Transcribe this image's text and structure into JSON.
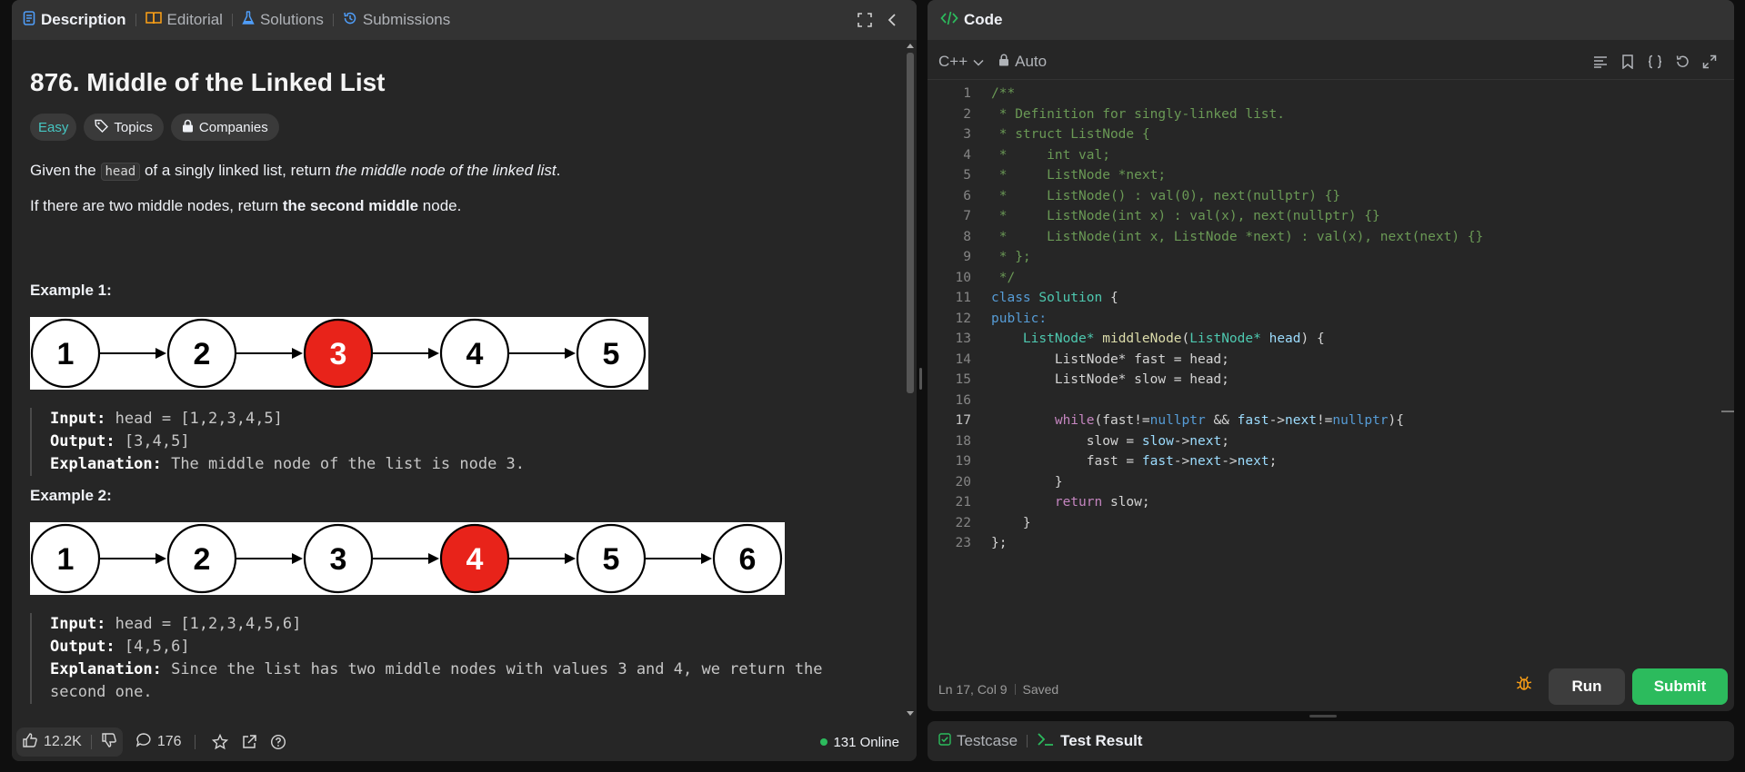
{
  "left_tabs": [
    {
      "label": "Description",
      "icon": "document-icon",
      "active": true
    },
    {
      "label": "Editorial",
      "icon": "book-icon",
      "active": false
    },
    {
      "label": "Solutions",
      "icon": "flask-icon",
      "active": false
    },
    {
      "label": "Submissions",
      "icon": "history-icon",
      "active": false
    }
  ],
  "problem": {
    "title": "876. Middle of the Linked List",
    "difficulty": "Easy",
    "topics_label": "Topics",
    "companies_label": "Companies",
    "para1_prefix": "Given the ",
    "para1_code": "head",
    "para1_middle": " of a singly linked list, return ",
    "para1_em": "the middle node of the linked list",
    "para1_suffix": ".",
    "para2_prefix": "If there are two middle nodes, return ",
    "para2_bold": "the second middle",
    "para2_suffix": " node."
  },
  "examples": [
    {
      "title": "Example 1:",
      "nodes": [
        "1",
        "2",
        "3",
        "4",
        "5"
      ],
      "highlight_index": 2,
      "input_label": "Input:",
      "input": "head = [1,2,3,4,5]",
      "output_label": "Output:",
      "output": "[3,4,5]",
      "explanation_label": "Explanation:",
      "explanation": "The middle node of the list is node 3."
    },
    {
      "title": "Example 2:",
      "nodes": [
        "1",
        "2",
        "3",
        "4",
        "5",
        "6"
      ],
      "highlight_index": 3,
      "input_label": "Input:",
      "input": "head = [1,2,3,4,5,6]",
      "output_label": "Output:",
      "output": "[4,5,6]",
      "explanation_label": "Explanation:",
      "explanation": "Since the list has two middle nodes with values 3 and 4, we return the",
      "explanation_cut": "second one."
    }
  ],
  "bottom_bar": {
    "likes": "12.2K",
    "comments": "176",
    "online": "131 Online"
  },
  "code_panel": {
    "title": "Code",
    "language": "C++",
    "mode": "Auto",
    "status_position": "Ln 17, Col 9",
    "status_saved": "Saved",
    "run_label": "Run",
    "submit_label": "Submit",
    "current_line": 17
  },
  "result_tabs": [
    {
      "label": "Testcase",
      "icon": "checkbox-icon",
      "active": false
    },
    {
      "label": "Test Result",
      "icon": "terminal-icon",
      "active": true
    }
  ],
  "code_lines": [
    [
      [
        "cm",
        "/**"
      ]
    ],
    [
      [
        "cm",
        " * Definition for singly-linked list."
      ]
    ],
    [
      [
        "cm",
        " * struct ListNode {"
      ]
    ],
    [
      [
        "cm",
        " *     int val;"
      ]
    ],
    [
      [
        "cm",
        " *     ListNode *next;"
      ]
    ],
    [
      [
        "cm",
        " *     ListNode() : val(0), next(nullptr) {}"
      ]
    ],
    [
      [
        "cm",
        " *     ListNode(int x) : val(x), next(nullptr) {}"
      ]
    ],
    [
      [
        "cm",
        " *     ListNode(int x, ListNode *next) : val(x), next(next) {}"
      ]
    ],
    [
      [
        "cm",
        " * };"
      ]
    ],
    [
      [
        "cm",
        " */"
      ]
    ],
    [
      [
        "kw",
        "class"
      ],
      [
        "",
        " "
      ],
      [
        "ty",
        "Solution"
      ],
      [
        "",
        " {"
      ]
    ],
    [
      [
        "kw",
        "public:"
      ]
    ],
    [
      [
        "",
        "    "
      ],
      [
        "ty",
        "ListNode*"
      ],
      [
        "",
        " "
      ],
      [
        "fn",
        "middleNode"
      ],
      [
        "",
        "("
      ],
      [
        "ty",
        "ListNode*"
      ],
      [
        "",
        " "
      ],
      [
        "va",
        "head"
      ],
      [
        "",
        ") {"
      ]
    ],
    [
      [
        "",
        "        ListNode* fast = head;"
      ]
    ],
    [
      [
        "",
        "        ListNode* slow = head;"
      ]
    ],
    [
      [
        "",
        ""
      ]
    ],
    [
      [
        "",
        "        "
      ],
      [
        "kc",
        "while"
      ],
      [
        "",
        "(fast!="
      ],
      [
        "kw",
        "nullptr"
      ],
      [
        "",
        " && "
      ],
      [
        "va",
        "fast"
      ],
      [
        "",
        "->"
      ],
      [
        "va",
        "next"
      ],
      [
        "",
        "!="
      ],
      [
        "kw",
        "nullptr"
      ],
      [
        "",
        "){"
      ]
    ],
    [
      [
        "",
        "            slow = "
      ],
      [
        "va",
        "slow"
      ],
      [
        "",
        "->"
      ],
      [
        "va",
        "next"
      ],
      [
        "",
        ";"
      ]
    ],
    [
      [
        "",
        "            fast = "
      ],
      [
        "va",
        "fast"
      ],
      [
        "",
        "->"
      ],
      [
        "va",
        "next"
      ],
      [
        "",
        "->"
      ],
      [
        "va",
        "next"
      ],
      [
        "",
        ";"
      ]
    ],
    [
      [
        "",
        "        }"
      ]
    ],
    [
      [
        "",
        "        "
      ],
      [
        "kc",
        "return"
      ],
      [
        "",
        " slow;"
      ]
    ],
    [
      [
        "",
        "    }"
      ]
    ],
    [
      [
        "",
        "};"
      ]
    ]
  ],
  "colors": {
    "accent_green": "#2cbb5d",
    "easy_teal": "#46c6c2",
    "node_red": "#e8231a"
  }
}
